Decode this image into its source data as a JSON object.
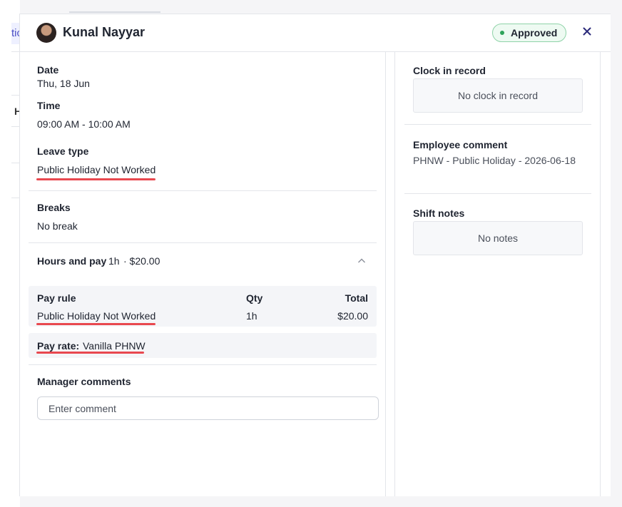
{
  "background": {
    "fragment_top": "tic",
    "fragment_mid": "H"
  },
  "header": {
    "employee_name": "Kunal Nayyar",
    "status": "Approved",
    "status_color": "#2fa35a",
    "close_icon": "close-icon"
  },
  "details": {
    "date_label": "Date",
    "date_value": "Thu, 18 Jun",
    "time_label": "Time",
    "time_value": "09:00 AM - 10:00 AM",
    "leave_type_label": "Leave type",
    "leave_type_value": "Public Holiday Not Worked",
    "breaks_label": "Breaks",
    "breaks_value": "No break"
  },
  "hours_pay": {
    "title": "Hours and pay",
    "hours": "1h",
    "amount": "· $20.00",
    "toggle_icon": "chevron-up-icon",
    "columns": {
      "rule": "Pay rule",
      "qty": "Qty",
      "total": "Total"
    },
    "rows": [
      {
        "rule": "Public Holiday Not Worked",
        "qty": "1h",
        "total": "$20.00"
      }
    ],
    "pay_rate_label": "Pay rate:",
    "pay_rate_value": "Vanilla PHNW"
  },
  "manager_comments": {
    "label": "Manager comments",
    "placeholder": "Enter comment",
    "value": ""
  },
  "right": {
    "clock_label": "Clock in record",
    "clock_value": "No clock in record",
    "employee_comment_label": "Employee comment",
    "employee_comment_value": "PHNW - Public Holiday - 2026-06-18",
    "shift_notes_label": "Shift notes",
    "shift_notes_value": "No notes"
  },
  "annotation_color": "#e8484f"
}
